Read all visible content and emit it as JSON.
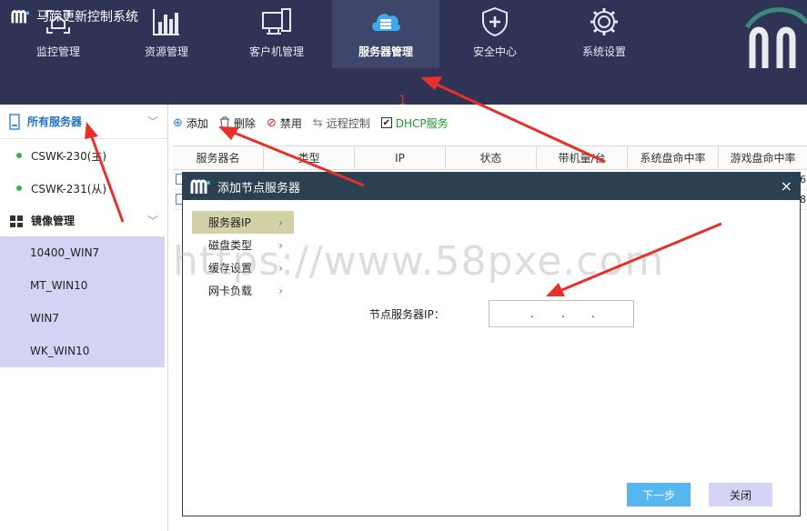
{
  "app": {
    "title": "马蹄更新控制系统"
  },
  "nav": [
    {
      "label": "监控管理",
      "icon": "monitor-home-icon"
    },
    {
      "label": "资源管理",
      "icon": "bar-chart-icon"
    },
    {
      "label": "客户机管理",
      "icon": "desktop-icon"
    },
    {
      "label": "服务器管理",
      "icon": "cloud-server-icon",
      "active": true
    },
    {
      "label": "安全中心",
      "icon": "shield-icon"
    },
    {
      "label": "系统设置",
      "icon": "gear-icon"
    }
  ],
  "sidebar": {
    "all_servers": "所有服务器",
    "servers": [
      "CSWK-230(主)",
      "CSWK-231(从)"
    ],
    "image_mgmt": "镜像管理",
    "images": [
      "10400_WIN7",
      "MT_WIN10",
      "WIN7",
      "WK_WIN10"
    ]
  },
  "toolbar": {
    "add": "添加",
    "delete": "删除",
    "disable": "禁用",
    "remote": "远程控制",
    "dhcp": "DHCP服务",
    "dhcp_checked": true
  },
  "table": {
    "headers": [
      "服务器名",
      "类型",
      "IP",
      "状态",
      "带机量/台",
      "系统盘命中率",
      "游戏盘命中率"
    ],
    "row_tails": [
      "6",
      "8"
    ]
  },
  "dialog": {
    "title": "添加节点服务器",
    "close": "×",
    "menu": [
      "服务器IP",
      "磁盘类型",
      "缓存设置",
      "网卡负载"
    ],
    "active_menu": "服务器IP",
    "ip_label": "节点服务器IP：",
    "ip_dots": [
      ".",
      ".",
      "."
    ],
    "next": "下一步",
    "close_btn": "关闭"
  },
  "annotation": {
    "step": "1"
  },
  "watermark": "https://www.58pxe.com",
  "colors": {
    "header_bg": "#2f3456",
    "dialog_header": "#2b4151",
    "selected_bg": "#d5d3f3",
    "dhcp_green": "#1e9a2e",
    "arrow_red": "#e6312a",
    "primary_btn": "#56b6f0"
  }
}
